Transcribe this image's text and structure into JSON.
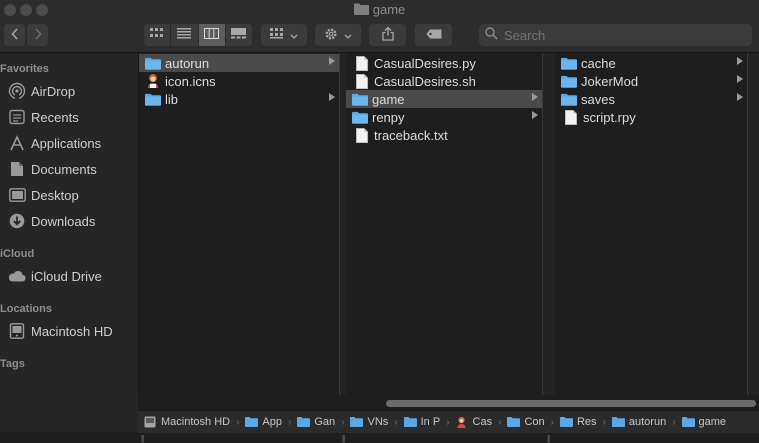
{
  "window": {
    "title": "game"
  },
  "toolbar": {
    "search_placeholder": "Search"
  },
  "sidebar": {
    "sections": [
      {
        "label": "Favorites",
        "items": [
          {
            "label": "AirDrop",
            "icon": "airdrop-icon"
          },
          {
            "label": "Recents",
            "icon": "recents-icon"
          },
          {
            "label": "Applications",
            "icon": "applications-icon"
          },
          {
            "label": "Documents",
            "icon": "documents-icon"
          },
          {
            "label": "Desktop",
            "icon": "desktop-icon"
          },
          {
            "label": "Downloads",
            "icon": "downloads-icon"
          }
        ]
      },
      {
        "label": "iCloud",
        "items": [
          {
            "label": "iCloud Drive",
            "icon": "cloud-icon"
          }
        ]
      },
      {
        "label": "Locations",
        "items": [
          {
            "label": "Macintosh HD",
            "icon": "harddrive-icon"
          }
        ]
      },
      {
        "label": "Tags",
        "items": []
      }
    ]
  },
  "columns": [
    {
      "items": [
        {
          "name": "autorun",
          "type": "folder",
          "selected": true,
          "has_children": true
        },
        {
          "name": "icon.icns",
          "type": "image",
          "selected": false,
          "has_children": false
        },
        {
          "name": "lib",
          "type": "folder",
          "selected": false,
          "has_children": true
        }
      ]
    },
    {
      "items": [
        {
          "name": "CasualDesires.py",
          "type": "file",
          "selected": false,
          "has_children": false
        },
        {
          "name": "CasualDesires.sh",
          "type": "file",
          "selected": false,
          "has_children": false
        },
        {
          "name": "game",
          "type": "folder",
          "selected": true,
          "has_children": true
        },
        {
          "name": "renpy",
          "type": "folder",
          "selected": false,
          "has_children": true
        },
        {
          "name": "traceback.txt",
          "type": "file",
          "selected": false,
          "has_children": false
        }
      ]
    },
    {
      "items": [
        {
          "name": "cache",
          "type": "folder",
          "selected": false,
          "has_children": true
        },
        {
          "name": "JokerMod",
          "type": "folder",
          "selected": false,
          "has_children": true
        },
        {
          "name": "saves",
          "type": "folder",
          "selected": false,
          "has_children": true
        },
        {
          "name": "script.rpy",
          "type": "file",
          "selected": false,
          "has_children": false
        }
      ]
    }
  ],
  "pathbar": [
    {
      "label": "Macintosh HD",
      "icon": "harddrive-icon"
    },
    {
      "label": "App",
      "icon": "folder-icon"
    },
    {
      "label": "Gan",
      "icon": "folder-icon"
    },
    {
      "label": "VNs",
      "icon": "folder-icon"
    },
    {
      "label": "In P",
      "icon": "folder-icon"
    },
    {
      "label": "Cas",
      "icon": "app-icon"
    },
    {
      "label": "Con",
      "icon": "folder-icon"
    },
    {
      "label": "Res",
      "icon": "folder-icon"
    },
    {
      "label": "autorun",
      "icon": "folder-icon"
    },
    {
      "label": "game",
      "icon": "folder-icon"
    }
  ],
  "colors": {
    "folder": "#5aa9e6",
    "selection": "#4a4a4a",
    "sidebar_bg": "#262626"
  }
}
